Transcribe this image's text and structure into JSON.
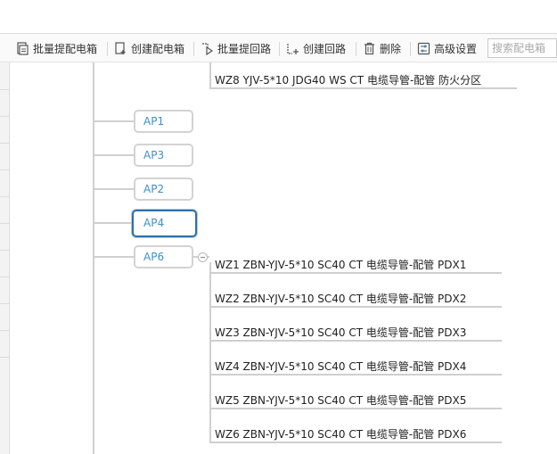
{
  "toolbar": {
    "buttons": [
      {
        "label": "批量提配电箱",
        "icon": "batch-box-icon"
      },
      {
        "label": "创建配电箱",
        "icon": "add-box-icon"
      },
      {
        "label": "批量提回路",
        "icon": "batch-circuit-icon"
      },
      {
        "label": "创建回路",
        "icon": "add-circuit-icon"
      },
      {
        "label": "删除",
        "icon": "trash-icon"
      },
      {
        "label": "高级设置",
        "icon": "settings-icon"
      }
    ],
    "search_placeholder": "搜索配电箱"
  },
  "tree": {
    "top_circuit": "WZ8 YJV-5*10 JDG40 WS CT 电缆导管-配管 防火分区",
    "boxes": [
      {
        "label": "AP1",
        "selected": false
      },
      {
        "label": "AP3",
        "selected": false
      },
      {
        "label": "AP2",
        "selected": false
      },
      {
        "label": "AP4",
        "selected": true
      },
      {
        "label": "AP6",
        "selected": false
      }
    ],
    "ap6_circuits": [
      "WZ1 ZBN-YJV-5*10 SC40 CT 电缆导管-配管 PDX1",
      "WZ2 ZBN-YJV-5*10 SC40 CT 电缆导管-配管 PDX2",
      "WZ3 ZBN-YJV-5*10 SC40 CT 电缆导管-配管 PDX3",
      "WZ4 ZBN-YJV-5*10 SC40 CT 电缆导管-配管 PDX4",
      "WZ5 ZBN-YJV-5*10 SC40 CT 电缆导管-配管 PDX5",
      "WZ6 ZBN-YJV-5*10 SC40 CT 电缆导管-配管 PDX6"
    ]
  },
  "colors": {
    "node_text": "#3c8fd0",
    "selected_border": "#2e6fa8",
    "line": "#d0d0d0"
  }
}
